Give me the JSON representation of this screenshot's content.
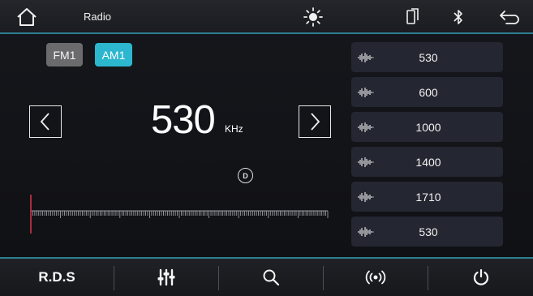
{
  "top_bar": {
    "title": "Radio",
    "icons": [
      "home-icon",
      "brightness-icon",
      "phone-link-icon",
      "bluetooth-icon",
      "back-arrow-icon"
    ]
  },
  "bands": [
    {
      "label": "FM1",
      "active": false
    },
    {
      "label": "AM1",
      "active": true
    }
  ],
  "tuner": {
    "frequency": "530",
    "unit": "KHz",
    "dx_badge": "D",
    "tuned_fraction": 0.0
  },
  "presets": [
    {
      "freq": "530",
      "active": true
    },
    {
      "freq": "600",
      "active": false
    },
    {
      "freq": "1000",
      "active": false
    },
    {
      "freq": "1400",
      "active": false
    },
    {
      "freq": "1710",
      "active": false
    },
    {
      "freq": "530",
      "active": false
    }
  ],
  "bottom_bar": {
    "rds_label": "R.D.S",
    "icons": [
      "equalizer-icon",
      "search-icon",
      "signal-icon",
      "power-icon"
    ]
  },
  "colors": {
    "accent": "#2cb7cf",
    "marker": "#d0344a",
    "panel": "#242631"
  }
}
